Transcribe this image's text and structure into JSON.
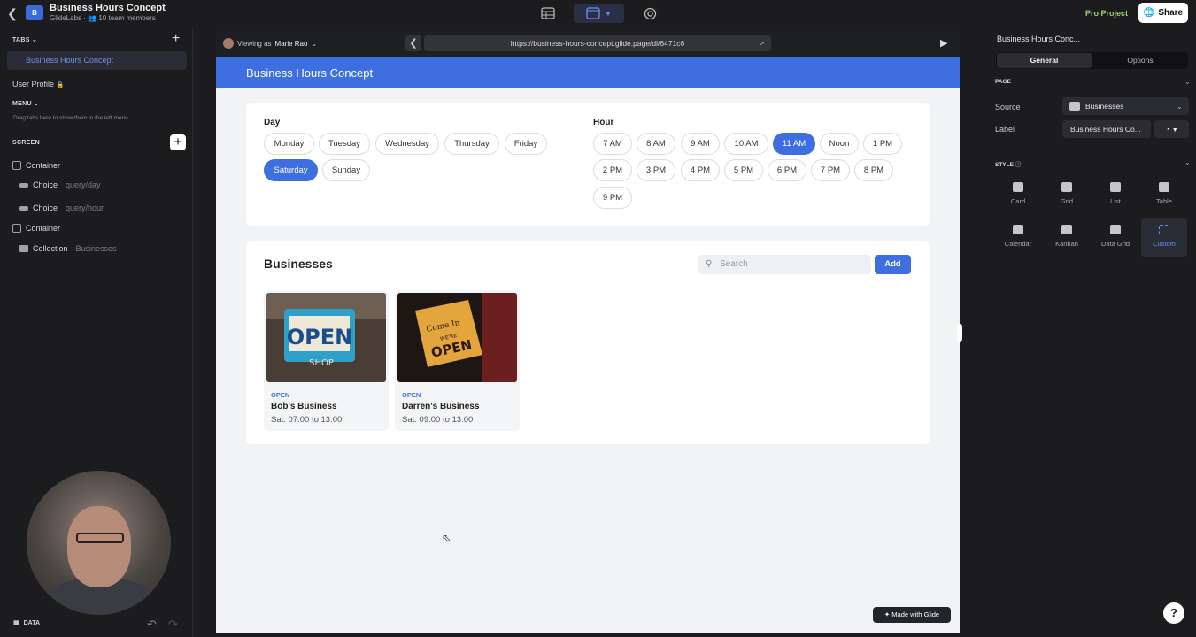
{
  "app": {
    "title": "Business Hours Concept",
    "org": "GlideLabs",
    "members": "10 team members",
    "logo_letter": "B"
  },
  "toolbar": {
    "pro": "Pro Project",
    "share": "Share"
  },
  "left": {
    "tabs_label": "TABS",
    "tab_selected": "Business Hours Concept",
    "user_profile": "User Profile",
    "menu_label": "MENU",
    "menu_hint": "Drag tabs here to show them in the left menu.",
    "screen_label": "SCREEN",
    "tree": [
      {
        "type": "Container",
        "q": ""
      },
      {
        "type": "Choice",
        "q": "query/day"
      },
      {
        "type": "Choice",
        "q": "query/hour"
      },
      {
        "type": "Container",
        "q": ""
      },
      {
        "type": "Collection",
        "q": "Businesses"
      }
    ],
    "data_label": "DATA"
  },
  "browser": {
    "viewing_prefix": "Viewing as",
    "viewer": "Marie Rao",
    "url": "https://business-hours-concept.glide.page/dl/6471c6"
  },
  "page": {
    "header": "Business Hours Concept",
    "day_label": "Day",
    "days": [
      "Monday",
      "Tuesday",
      "Wednesday",
      "Thursday",
      "Friday",
      "Saturday",
      "Sunday"
    ],
    "selected_day": "Saturday",
    "hour_label": "Hour",
    "hours": [
      "7 AM",
      "8 AM",
      "9 AM",
      "10 AM",
      "11 AM",
      "Noon",
      "1 PM",
      "2 PM",
      "3 PM",
      "4 PM",
      "5 PM",
      "6 PM",
      "7 PM",
      "8 PM",
      "9 PM"
    ],
    "selected_hour": "11 AM",
    "businesses_title": "Businesses",
    "search_placeholder": "Search",
    "add_label": "Add",
    "businesses": [
      {
        "status": "OPEN",
        "name": "Bob's Business",
        "hours": "Sat: 07:00 to 13:00"
      },
      {
        "status": "OPEN",
        "name": "Darren's Business",
        "hours": "Sat: 09:00 to 13:00"
      }
    ],
    "img1": {
      "line1": "OPEN",
      "line2": "SHOP"
    },
    "img2": {
      "line1": "Come In",
      "line2": "WE'RE",
      "line3": "OPEN"
    },
    "made_with": "Made with Glide"
  },
  "right": {
    "title": "Business Hours Conc...",
    "seg_general": "General",
    "seg_options": "Options",
    "page_label": "PAGE",
    "source_label": "Source",
    "source_value": "Businesses",
    "label_label": "Label",
    "label_value": "Business Hours Co...",
    "style_label": "STYLE",
    "styles": [
      "Card",
      "Grid",
      "List",
      "Table",
      "Calendar",
      "Kanban",
      "Data Grid",
      "Custom"
    ],
    "selected_style": "Custom"
  },
  "colors": {
    "accent": "#3d6fe0",
    "panel": "#1c1c1f"
  }
}
